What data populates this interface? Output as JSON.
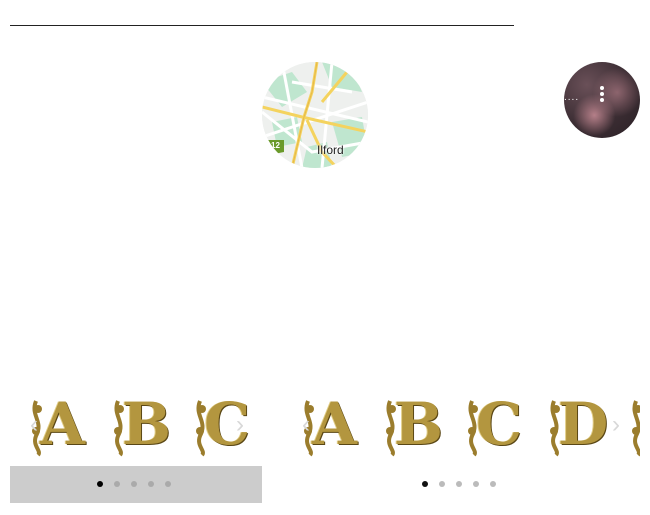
{
  "map": {
    "place_label": "Ilford",
    "road_badge": "12"
  },
  "avatar": {
    "truncated_text": "....",
    "more_icon": "more-vertical-icon"
  },
  "carousels": [
    {
      "letters": [
        "A",
        "B",
        "C"
      ],
      "prev_icon": "chevron-left-icon",
      "next_icon": "chevron-right-icon",
      "dot_count": 5,
      "active_dot": 0
    },
    {
      "letters": [
        "A",
        "B",
        "C",
        "D"
      ],
      "prev_icon": "chevron-left-icon",
      "next_icon": "chevron-right-icon",
      "dot_count": 5,
      "active_dot": 0
    }
  ],
  "colors": {
    "gold": "#b3963f",
    "dots_bar_gray": "#cccccc",
    "map_green": "#9fd7b5",
    "map_yellow": "#f4d35e"
  }
}
